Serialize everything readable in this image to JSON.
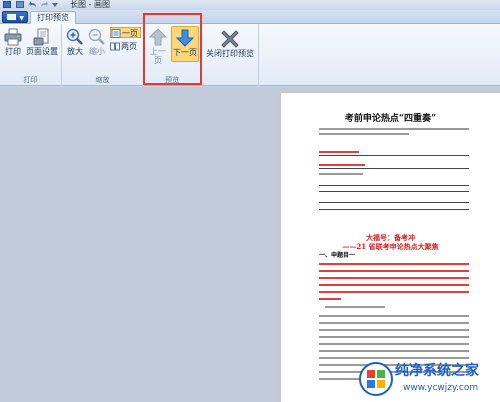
{
  "window": {
    "title": "长图 - 画图"
  },
  "tabs": [
    {
      "label": "打印预览"
    }
  ],
  "ribbon": {
    "print_group": {
      "label": "打印",
      "print_label": "打印",
      "page_setup_label": "页面设置"
    },
    "zoom_group": {
      "label": "缩放",
      "zoom_in_label": "放大",
      "zoom_out_label": "缩小",
      "one_page_label": "一页",
      "two_pages_label": "两页"
    },
    "nav_group": {
      "label": "预览",
      "prev_label": "上一页",
      "next_label": "下一页"
    },
    "close_group": {
      "close_label": "关闭打印预览"
    }
  },
  "document": {
    "title": "考前申论热点“四重奏”",
    "section_title": "大福号：备考冲",
    "section_subtitle": "——21 省联考申论热点大聚焦",
    "first_heading": "一、申题目一"
  },
  "watermark": {
    "title": "纯净系统之家",
    "url": "www.ycwjzy.com"
  },
  "colors": {
    "accent_blue": "#1f5fc4",
    "highlight_red": "#e53935",
    "doc_red": "#d32020"
  }
}
